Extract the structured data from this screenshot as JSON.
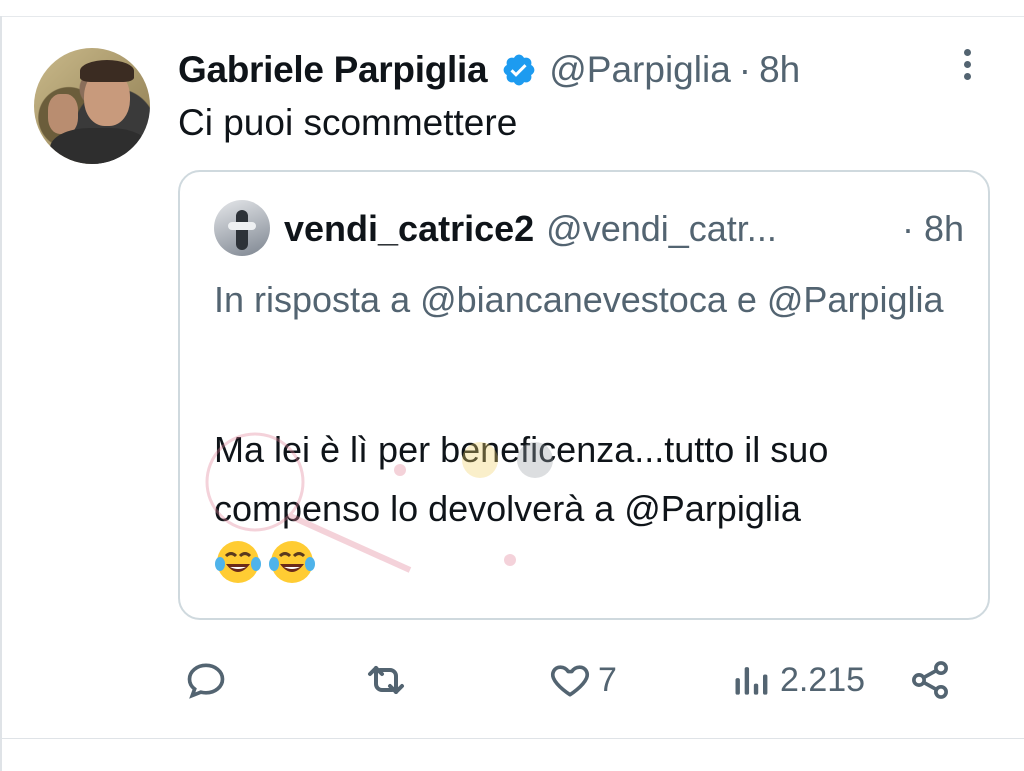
{
  "tweet": {
    "author_name": "Gabriele Parpiglia",
    "author_handle": "@Parpiglia",
    "separator": "·",
    "time": "8h",
    "text": "Ci puoi scommettere"
  },
  "quoted": {
    "author_name": "vendi_catrice2",
    "author_handle": "@vendi_catr...",
    "time": "· 8h",
    "reply_to": "In risposta a @biancanevestoca e @Parpiglia",
    "body": "Ma lei è lì per beneficenza...tutto il suo compenso lo devolverà a @Parpiglia",
    "emoji_names": [
      "tears-of-joy-emoji",
      "tears-of-joy-emoji"
    ]
  },
  "actions": {
    "reply_count": "",
    "retweet_count": "",
    "like_count": "7",
    "views_count": "2.215"
  },
  "colors": {
    "verified": "#1d9bf0",
    "secondary_text": "#536471",
    "border": "#cfd9de",
    "watermark": "#e07f94"
  },
  "icons": {
    "reply": "speech-bubble-icon",
    "retweet": "retweet-icon",
    "like": "heart-icon",
    "views": "bar-chart-icon",
    "share": "share-icon",
    "more": "more-vertical-icon",
    "verified": "verified-badge-icon"
  }
}
